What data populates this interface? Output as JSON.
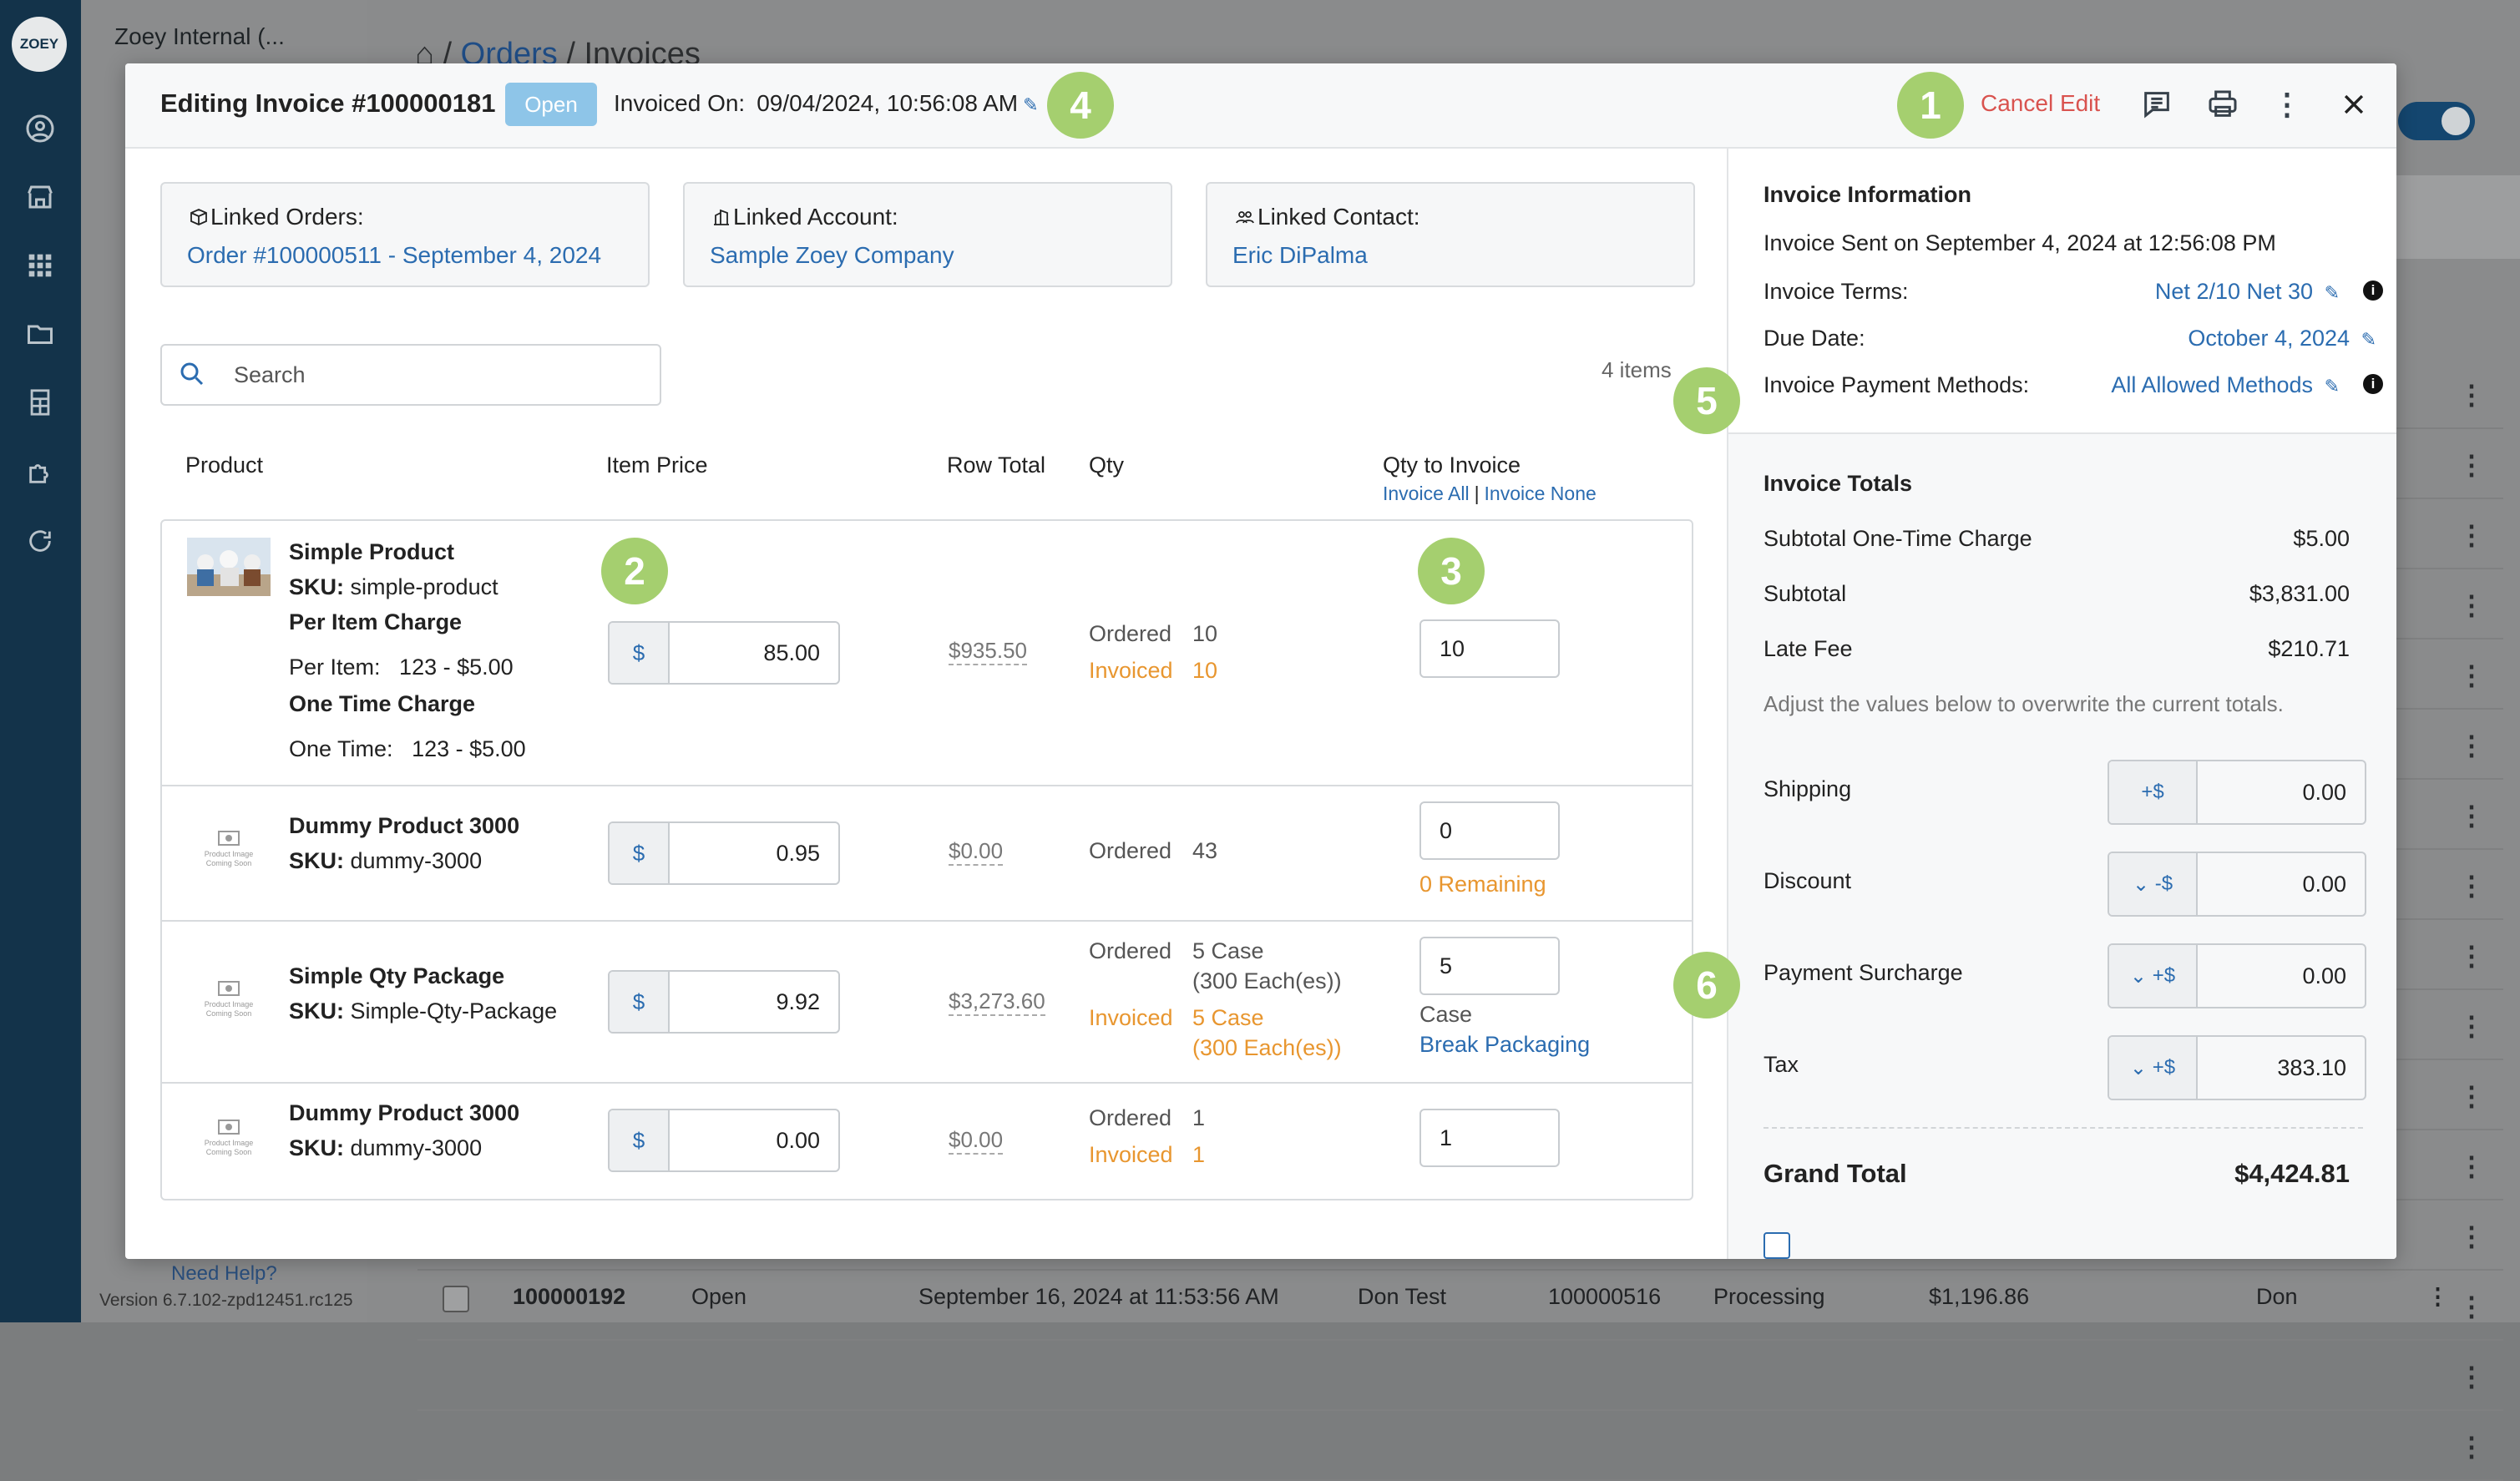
{
  "background": {
    "logo": "ZOEY",
    "panel_title": "Zoey Internal (...",
    "breadcrumb": [
      "Orders",
      "Invoices"
    ],
    "help_link": "Need Help?",
    "version": "Version 6.7.102-zpd12451.rc125",
    "bottom_row": {
      "number": "100000192",
      "status": "Open",
      "date": "September 16, 2024 at 11:53:56 AM",
      "name": "Don Test",
      "order": "100000516",
      "state": "Processing",
      "amount": "$1,196.86",
      "user": "Don"
    }
  },
  "modal": {
    "title": "Editing Invoice #100000181",
    "status": "Open",
    "invoiced_on_label": "Invoiced On:",
    "invoiced_on_value": "09/04/2024, 10:56:08 AM",
    "cancel_edit": "Cancel Edit",
    "badges": [
      "1",
      "2",
      "3",
      "4",
      "5",
      "6"
    ],
    "linked": {
      "orders_label": "Linked Orders:",
      "orders_value": "Order #100000511 - September 4, 2024",
      "account_label": "Linked Account:",
      "account_value": "Sample Zoey Company",
      "contact_label": "Linked Contact:",
      "contact_value": "Eric DiPalma"
    },
    "search_placeholder": "Search",
    "items_count": "4 items",
    "columns": {
      "product": "Product",
      "item_price": "Item Price",
      "row_total": "Row Total",
      "qty": "Qty",
      "qty_to_invoice": "Qty to Invoice",
      "invoice_all": "Invoice All",
      "invoice_none": "Invoice None"
    },
    "rows": [
      {
        "name": "Simple Product",
        "sku_label": "SKU:",
        "sku": "simple-product",
        "extra1_title": "Per Item Charge",
        "extra1_label": "Per Item:",
        "extra1_value": "123 - $5.00",
        "extra2_title": "One Time Charge",
        "extra2_label": "One Time:",
        "extra2_value": "123 - $5.00",
        "currency": "$",
        "price": "85.00",
        "row_total": "$935.50",
        "ordered_label": "Ordered",
        "ordered": "10",
        "invoiced_label": "Invoiced",
        "invoiced": "10",
        "qty_to_invoice": "10"
      },
      {
        "name": "Dummy Product 3000",
        "sku_label": "SKU:",
        "sku": "dummy-3000",
        "currency": "$",
        "price": "0.95",
        "row_total": "$0.00",
        "ordered_label": "Ordered",
        "ordered": "43",
        "qty_to_invoice": "0",
        "note": "0 Remaining"
      },
      {
        "name": "Simple Qty Package",
        "sku_label": "SKU:",
        "sku": "Simple-Qty-Package",
        "currency": "$",
        "price": "9.92",
        "row_total": "$3,273.60",
        "ordered_label": "Ordered",
        "ordered": "5 Case",
        "ordered_sub": "(300 Each(es))",
        "invoiced_label": "Invoiced",
        "invoiced": "5 Case",
        "invoiced_sub": "(300 Each(es))",
        "qty_to_invoice": "5",
        "unit": "Case",
        "break_link": "Break Packaging"
      },
      {
        "name": "Dummy Product 3000",
        "sku_label": "SKU:",
        "sku": "dummy-3000",
        "currency": "$",
        "price": "0.00",
        "row_total": "$0.00",
        "ordered_label": "Ordered",
        "ordered": "1",
        "invoiced_label": "Invoiced",
        "invoiced": "1",
        "qty_to_invoice": "1"
      }
    ],
    "info": {
      "heading": "Invoice Information",
      "sent": "Invoice Sent on September 4, 2024 at 12:56:08 PM",
      "terms_label": "Invoice Terms:",
      "terms_value": "Net 2/10 Net 30",
      "due_label": "Due Date:",
      "due_value": "October 4, 2024",
      "methods_label": "Invoice Payment Methods:",
      "methods_value": "All Allowed Methods"
    },
    "totals": {
      "heading": "Invoice Totals",
      "subtotal_one_time_label": "Subtotal One-Time Charge",
      "subtotal_one_time": "$5.00",
      "subtotal_label": "Subtotal",
      "subtotal": "$3,831.00",
      "late_fee_label": "Late Fee",
      "late_fee": "$210.71",
      "note": "Adjust the values below to overwrite the current totals.",
      "shipping_label": "Shipping",
      "shipping_prefix": "+$",
      "shipping": "0.00",
      "discount_label": "Discount",
      "discount_prefix": "-$",
      "discount": "0.00",
      "surcharge_label": "Payment Surcharge",
      "surcharge_prefix": "+$",
      "surcharge": "0.00",
      "tax_label": "Tax",
      "tax_prefix": "+$",
      "tax": "383.10",
      "grand_label": "Grand Total",
      "grand": "$4,424.81"
    }
  },
  "colors": {
    "accent": "#2b6cb0",
    "badge": "#a5cf6f",
    "cancel": "#d9534f",
    "warning": "#e8962f",
    "sidebar": "#13334a"
  }
}
